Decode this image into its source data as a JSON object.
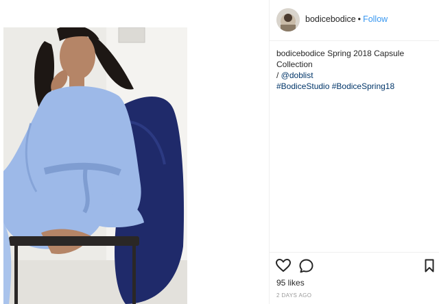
{
  "post": {
    "image_alt_icon": "photo-of-model-in-blue-wrap-dress",
    "author": {
      "username": "bodicebodice",
      "separator": "•",
      "follow_label": "Follow"
    },
    "caption": {
      "author": "bodicebodice",
      "text": " Spring 2018 Capsule Collection",
      "line2_prefix": "/ ",
      "camera_glyph": "",
      "line2_mention_pre": " ",
      "mention": "@doblist",
      "hashtags": [
        "#BodiceStudio",
        "#BodiceSpring18"
      ]
    },
    "likes": "95 likes",
    "time_ago": "2 DAYS AGO"
  },
  "colors": {
    "link": "#3897f0",
    "tag": "#003569",
    "dress": "#9db9e8",
    "jacket": "#1e2a6e"
  }
}
